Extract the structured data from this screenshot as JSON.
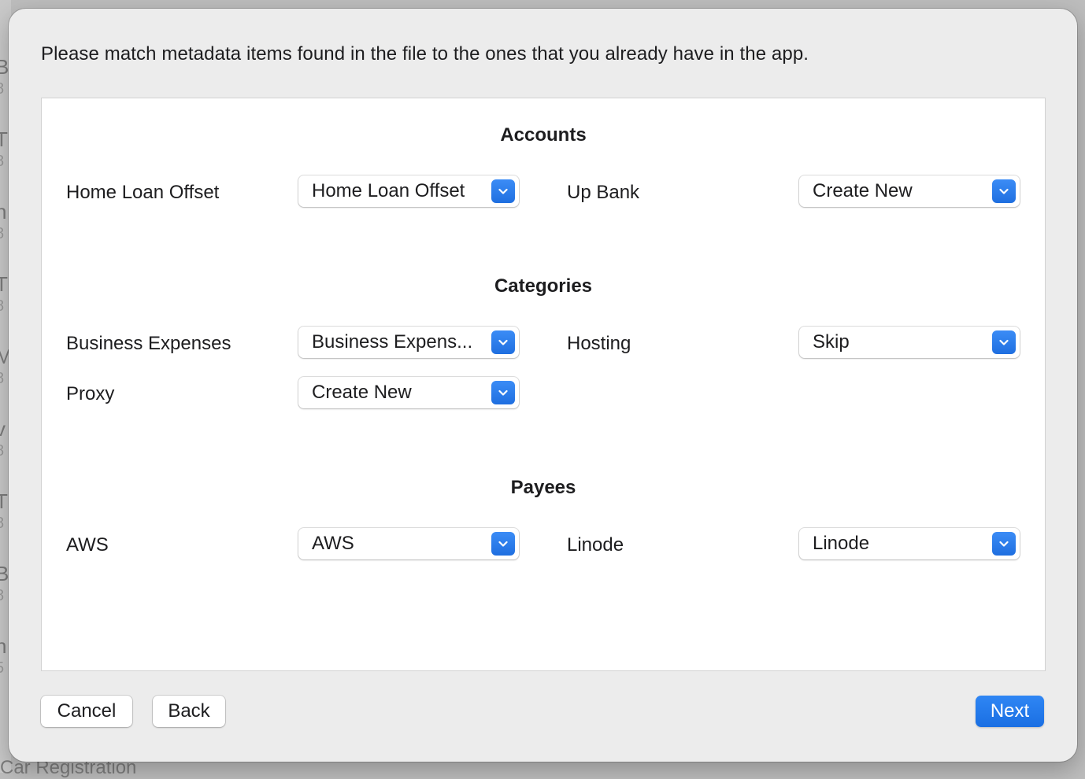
{
  "background": {
    "bottom_text": "Car Registration"
  },
  "dialog": {
    "instruction": "Please match metadata items found in the file to the ones that you already have in the app.",
    "sections": {
      "accounts": {
        "title": "Accounts",
        "rows": [
          {
            "label": "Home Loan Offset",
            "selected": "Home Loan Offset"
          },
          {
            "label": "Up Bank",
            "selected": "Create New"
          }
        ]
      },
      "categories": {
        "title": "Categories",
        "rows": [
          {
            "label": "Business Expenses",
            "selected": "Business Expens..."
          },
          {
            "label": "Hosting",
            "selected": "Skip"
          },
          {
            "label": "Proxy",
            "selected": "Create New"
          }
        ]
      },
      "payees": {
        "title": "Payees",
        "rows": [
          {
            "label": "AWS",
            "selected": "AWS"
          },
          {
            "label": "Linode",
            "selected": "Linode"
          }
        ]
      }
    },
    "buttons": {
      "cancel": "Cancel",
      "back": "Back",
      "next": "Next"
    },
    "colors": {
      "accent": "#1f6fe0",
      "dialog_bg": "#ececec",
      "panel_bg": "#ffffff"
    },
    "icons": {
      "popup_chevron": "chevron-down-icon"
    }
  }
}
